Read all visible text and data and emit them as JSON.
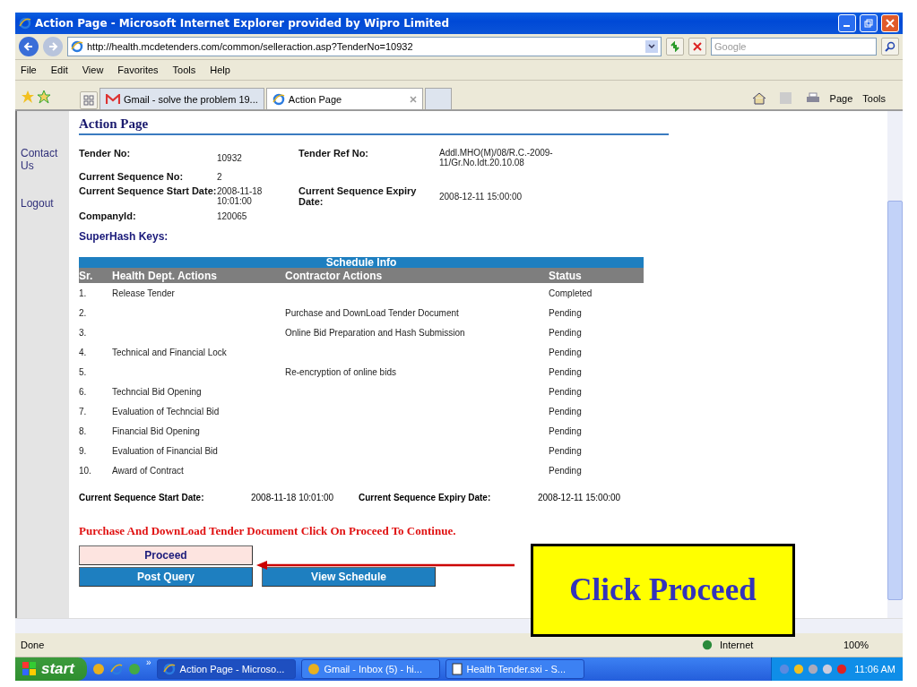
{
  "window": {
    "title": "Action Page - Microsoft Internet Explorer provided by Wipro Limited"
  },
  "address_bar": {
    "url": "http://health.mcdetenders.com/common/selleraction.asp?TenderNo=10932",
    "search_placeholder": "Google"
  },
  "menu": [
    "File",
    "Edit",
    "View",
    "Favorites",
    "Tools",
    "Help"
  ],
  "tabs": [
    {
      "label": "Gmail - solve the problem 19...",
      "kind": "gmail",
      "selected": false
    },
    {
      "label": "Action Page",
      "kind": "ie",
      "selected": true
    }
  ],
  "command_bar": [
    "Page",
    "Tools"
  ],
  "sidebar": {
    "links": [
      "Contact Us",
      "Logout"
    ]
  },
  "page": {
    "heading": "Action Page",
    "fields": [
      [
        {
          "label": "Tender No:",
          "value": "10932"
        },
        {
          "label": "Tender Ref No:",
          "value": "Addl.MHO(M)/08/R.C.-2009-11/Gr.No.Idt.20.10.08"
        }
      ],
      [
        {
          "label": "Current Sequence No:",
          "value": "2"
        }
      ],
      [
        {
          "label": "Current Sequence Start Date:",
          "value": "2008-11-18 10:01:00"
        },
        {
          "label": "Current Sequence Expiry Date:",
          "value": "2008-12-11 15:00:00"
        }
      ],
      [
        {
          "label": "CompanyId:",
          "value": "120065"
        }
      ]
    ],
    "superhash_label": "SuperHash Keys:"
  },
  "schedule": {
    "title": "Schedule Info",
    "columns": [
      "Sr.",
      "Health Dept. Actions",
      "Contractor Actions",
      "Status"
    ],
    "rows": [
      {
        "sr": "1.",
        "health": "Release Tender",
        "status": "Completed"
      },
      {
        "sr": "2.",
        "contractor": "Purchase and DownLoad Tender Document",
        "status": "Pending"
      },
      {
        "sr": "3.",
        "contractor": "Online Bid Preparation and Hash Submission",
        "status": "Pending"
      },
      {
        "sr": "4.",
        "health": "Technical and Financial Lock",
        "status": "Pending"
      },
      {
        "sr": "5.",
        "contractor": "Re-encryption of online bids",
        "status": "Pending"
      },
      {
        "sr": "6.",
        "health": "Techncial Bid Opening",
        "status": "Pending"
      },
      {
        "sr": "7.",
        "health": "Evaluation of Techncial Bid",
        "status": "Pending"
      },
      {
        "sr": "8.",
        "health": "Financial Bid Opening",
        "status": "Pending"
      },
      {
        "sr": "9.",
        "health": "Evaluation of Financial Bid",
        "status": "Pending"
      },
      {
        "sr": "10.",
        "health": "Award of Contract",
        "status": "Pending"
      }
    ]
  },
  "sequence_dates": [
    {
      "label": "Current Sequence Start Date:",
      "value": "2008-11-18 10:01:00"
    },
    {
      "label": "Current Sequence Expiry Date:",
      "value": "2008-12-11 15:00:00"
    }
  ],
  "notice": "Purchase And DownLoad Tender Document Click On Proceed To Continue.",
  "buttons": [
    {
      "label": "Proceed",
      "kind": "primary"
    },
    {
      "label": "Post Query",
      "kind": "secondary"
    },
    {
      "label": "View Schedule",
      "kind": "secondary"
    }
  ],
  "callout": {
    "text": "Click Proceed"
  },
  "status_bar": {
    "text": "Done",
    "zone": "Internet",
    "zoom": "100%"
  },
  "taskbar": {
    "start": "start",
    "more": "»",
    "items": [
      {
        "label": "Action Page - Microso...",
        "kind": "ie",
        "selected": true
      },
      {
        "label": "Gmail - Inbox (5) - hi...",
        "kind": "chrome",
        "selected": false
      },
      {
        "label": "Health Tender.sxi - S...",
        "kind": "doc",
        "selected": false
      }
    ],
    "clock": "11:06 AM"
  }
}
